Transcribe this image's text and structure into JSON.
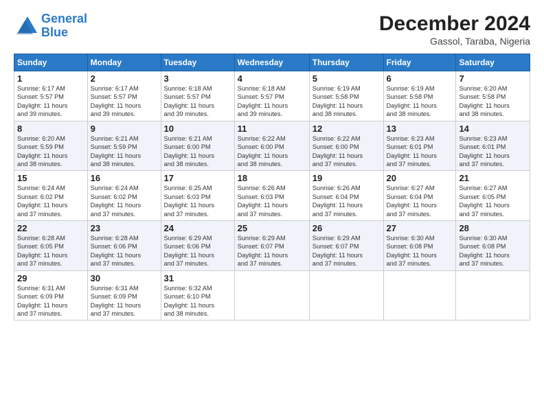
{
  "logo": {
    "line1": "General",
    "line2": "Blue"
  },
  "title": "December 2024",
  "subtitle": "Gassol, Taraba, Nigeria",
  "days_of_week": [
    "Sunday",
    "Monday",
    "Tuesday",
    "Wednesday",
    "Thursday",
    "Friday",
    "Saturday"
  ],
  "weeks": [
    [
      {
        "day": "1",
        "info": "Sunrise: 6:17 AM\nSunset: 5:57 PM\nDaylight: 11 hours\nand 39 minutes."
      },
      {
        "day": "2",
        "info": "Sunrise: 6:17 AM\nSunset: 5:57 PM\nDaylight: 11 hours\nand 39 minutes."
      },
      {
        "day": "3",
        "info": "Sunrise: 6:18 AM\nSunset: 5:57 PM\nDaylight: 11 hours\nand 39 minutes."
      },
      {
        "day": "4",
        "info": "Sunrise: 6:18 AM\nSunset: 5:57 PM\nDaylight: 11 hours\nand 39 minutes."
      },
      {
        "day": "5",
        "info": "Sunrise: 6:19 AM\nSunset: 5:58 PM\nDaylight: 11 hours\nand 38 minutes."
      },
      {
        "day": "6",
        "info": "Sunrise: 6:19 AM\nSunset: 5:58 PM\nDaylight: 11 hours\nand 38 minutes."
      },
      {
        "day": "7",
        "info": "Sunrise: 6:20 AM\nSunset: 5:58 PM\nDaylight: 11 hours\nand 38 minutes."
      }
    ],
    [
      {
        "day": "8",
        "info": "Sunrise: 6:20 AM\nSunset: 5:59 PM\nDaylight: 11 hours\nand 38 minutes."
      },
      {
        "day": "9",
        "info": "Sunrise: 6:21 AM\nSunset: 5:59 PM\nDaylight: 11 hours\nand 38 minutes."
      },
      {
        "day": "10",
        "info": "Sunrise: 6:21 AM\nSunset: 6:00 PM\nDaylight: 11 hours\nand 38 minutes."
      },
      {
        "day": "11",
        "info": "Sunrise: 6:22 AM\nSunset: 6:00 PM\nDaylight: 11 hours\nand 38 minutes."
      },
      {
        "day": "12",
        "info": "Sunrise: 6:22 AM\nSunset: 6:00 PM\nDaylight: 11 hours\nand 37 minutes."
      },
      {
        "day": "13",
        "info": "Sunrise: 6:23 AM\nSunset: 6:01 PM\nDaylight: 11 hours\nand 37 minutes."
      },
      {
        "day": "14",
        "info": "Sunrise: 6:23 AM\nSunset: 6:01 PM\nDaylight: 11 hours\nand 37 minutes."
      }
    ],
    [
      {
        "day": "15",
        "info": "Sunrise: 6:24 AM\nSunset: 6:02 PM\nDaylight: 11 hours\nand 37 minutes."
      },
      {
        "day": "16",
        "info": "Sunrise: 6:24 AM\nSunset: 6:02 PM\nDaylight: 11 hours\nand 37 minutes."
      },
      {
        "day": "17",
        "info": "Sunrise: 6:25 AM\nSunset: 6:03 PM\nDaylight: 11 hours\nand 37 minutes."
      },
      {
        "day": "18",
        "info": "Sunrise: 6:26 AM\nSunset: 6:03 PM\nDaylight: 11 hours\nand 37 minutes."
      },
      {
        "day": "19",
        "info": "Sunrise: 6:26 AM\nSunset: 6:04 PM\nDaylight: 11 hours\nand 37 minutes."
      },
      {
        "day": "20",
        "info": "Sunrise: 6:27 AM\nSunset: 6:04 PM\nDaylight: 11 hours\nand 37 minutes."
      },
      {
        "day": "21",
        "info": "Sunrise: 6:27 AM\nSunset: 6:05 PM\nDaylight: 11 hours\nand 37 minutes."
      }
    ],
    [
      {
        "day": "22",
        "info": "Sunrise: 6:28 AM\nSunset: 6:05 PM\nDaylight: 11 hours\nand 37 minutes."
      },
      {
        "day": "23",
        "info": "Sunrise: 6:28 AM\nSunset: 6:06 PM\nDaylight: 11 hours\nand 37 minutes."
      },
      {
        "day": "24",
        "info": "Sunrise: 6:29 AM\nSunset: 6:06 PM\nDaylight: 11 hours\nand 37 minutes."
      },
      {
        "day": "25",
        "info": "Sunrise: 6:29 AM\nSunset: 6:07 PM\nDaylight: 11 hours\nand 37 minutes."
      },
      {
        "day": "26",
        "info": "Sunrise: 6:29 AM\nSunset: 6:07 PM\nDaylight: 11 hours\nand 37 minutes."
      },
      {
        "day": "27",
        "info": "Sunrise: 6:30 AM\nSunset: 6:08 PM\nDaylight: 11 hours\nand 37 minutes."
      },
      {
        "day": "28",
        "info": "Sunrise: 6:30 AM\nSunset: 6:08 PM\nDaylight: 11 hours\nand 37 minutes."
      }
    ],
    [
      {
        "day": "29",
        "info": "Sunrise: 6:31 AM\nSunset: 6:09 PM\nDaylight: 11 hours\nand 37 minutes."
      },
      {
        "day": "30",
        "info": "Sunrise: 6:31 AM\nSunset: 6:09 PM\nDaylight: 11 hours\nand 37 minutes."
      },
      {
        "day": "31",
        "info": "Sunrise: 6:32 AM\nSunset: 6:10 PM\nDaylight: 11 hours\nand 38 minutes."
      },
      {
        "day": "",
        "info": ""
      },
      {
        "day": "",
        "info": ""
      },
      {
        "day": "",
        "info": ""
      },
      {
        "day": "",
        "info": ""
      }
    ]
  ]
}
